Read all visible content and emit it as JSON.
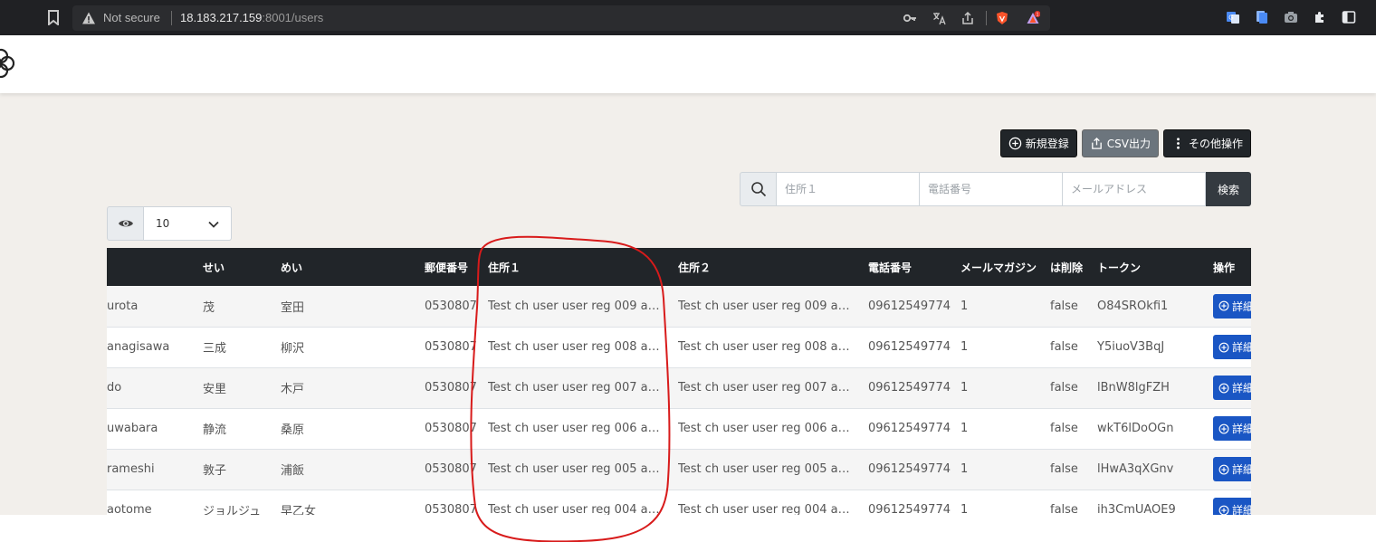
{
  "browser": {
    "security": "Not secure",
    "url_host": "18.183.217.159",
    "url_rest": ":8001/users"
  },
  "actions": {
    "new_label": "新規登録",
    "csv_label": "CSV出力",
    "other_label": "その他操作"
  },
  "search": {
    "address1_placeholder": "住所１",
    "phone_placeholder": "電話番号",
    "email_placeholder": "メールアドレス",
    "submit_label": "検索"
  },
  "perpage": {
    "value": "10"
  },
  "table": {
    "headers": [
      "",
      "せい",
      "めい",
      "郵便番号",
      "住所１",
      "住所２",
      "電話番号",
      "メールマガジン",
      "は削除",
      "トークン",
      "操作"
    ],
    "rows": [
      [
        "urota",
        "茂",
        "室田",
        "0530807",
        "Test ch user user reg 009 a…",
        "Test ch user user reg 009 a…",
        "09612549774",
        "1",
        "false",
        "O84SROkfi1",
        "詳細"
      ],
      [
        "anagisawa",
        "三成",
        "柳沢",
        "0530807",
        "Test ch user user reg 008 a…",
        "Test ch user user reg 008 a…",
        "09612549774",
        "1",
        "false",
        "Y5iuoV3BqJ",
        "詳細"
      ],
      [
        "do",
        "安里",
        "木戸",
        "0530807",
        "Test ch user user reg 007 a…",
        "Test ch user user reg 007 a…",
        "09612549774",
        "1",
        "false",
        "lBnW8lgFZH",
        "詳細"
      ],
      [
        "uwabara",
        "静流",
        "桑原",
        "0530807",
        "Test ch user user reg 006 a…",
        "Test ch user user reg 006 a…",
        "09612549774",
        "1",
        "false",
        "wkT6lDoOGn",
        "詳細"
      ],
      [
        "rameshi",
        "敦子",
        "浦飯",
        "0530807",
        "Test ch user user reg 005 a…",
        "Test ch user user reg 005 a…",
        "09612549774",
        "1",
        "false",
        "lHwA3qXGnv",
        "詳細"
      ],
      [
        "aotome",
        "ジョルジュ",
        "早乙女",
        "0530807",
        "Test ch user user reg 004 a…",
        "Test ch user user reg 004 a…",
        "09612549774",
        "1",
        "false",
        "ih3CmUAOE9",
        "詳細"
      ]
    ]
  },
  "colors": {
    "header_bg": "#212529",
    "content_bg": "#f2efeb",
    "primary": "#1a56c4",
    "annotation": "#d81b1b"
  }
}
